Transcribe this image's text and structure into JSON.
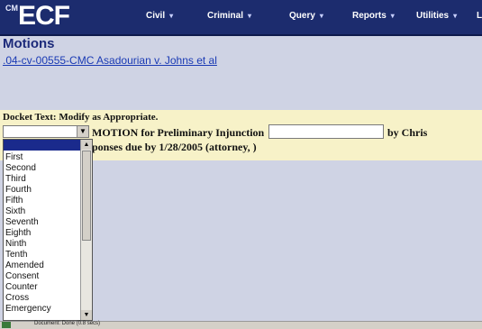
{
  "navbar": {
    "logo_prefix": "CM",
    "logo": "ECF",
    "menu": [
      {
        "label": "Civil",
        "arrow": "▾"
      },
      {
        "label": "Criminal",
        "arrow": "▾"
      },
      {
        "label": "Query",
        "arrow": "▾"
      },
      {
        "label": "Reports",
        "arrow": "▾"
      },
      {
        "label": "Utilities",
        "arrow": "▾"
      }
    ],
    "extra": "L"
  },
  "page": {
    "title": "Motions",
    "case_link": ".04-cv-00555-CMC Asadourian v. Johns et al"
  },
  "docket": {
    "label": "Docket Text: Modify as Appropriate.",
    "combo_value": "",
    "motion_text": "MOTION for Preliminary Injunction",
    "injunction_input": "",
    "by_text": "by Chris",
    "responses_text": "ponses due by 1/28/2005 (attorney, )"
  },
  "dropdown": {
    "options": [
      "First",
      "Second",
      "Third",
      "Fourth",
      "Fifth",
      "Sixth",
      "Seventh",
      "Eighth",
      "Ninth",
      "Tenth",
      "Amended",
      "Consent",
      "Counter",
      "Cross",
      "Emergency"
    ]
  },
  "statusbar": {
    "text": "Document: Done (0.8 secs)"
  },
  "colors": {
    "navbar": "#1c2c6e",
    "background": "#cfd3e4",
    "docket_bg": "#f7f2c8",
    "link": "#1a3ab4"
  }
}
